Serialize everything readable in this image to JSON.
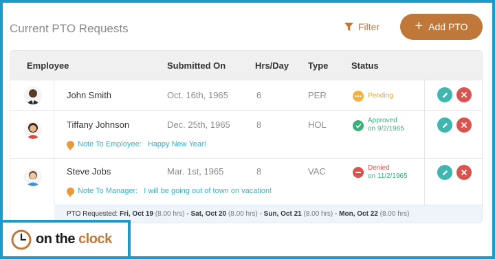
{
  "header": {
    "title": "Current PTO Requests",
    "filter_label": "Filter",
    "add_label": "Add PTO"
  },
  "table": {
    "columns": [
      "Employee",
      "Submitted On",
      "Hrs/Day",
      "Type",
      "Status"
    ],
    "rows": [
      {
        "name": "John Smith",
        "submitted": "Oct. 16th, 1965",
        "hrs": "6",
        "type": "PER",
        "status": "Pending",
        "status_date": ""
      },
      {
        "name": "Tiffany Johnson",
        "submitted": "Dec. 25th, 1965",
        "hrs": "8",
        "type": "HOL",
        "status": "Approved",
        "status_date": "on 9/2/1965",
        "note_label": "Note To Employee:",
        "note_text": "Happy New Year!"
      },
      {
        "name": "Steve Jobs",
        "submitted": "Mar. 1st, 1965",
        "hrs": "8",
        "type": "VAC",
        "status": "Denied",
        "status_date": "on 11/2/1965",
        "note_label": "Note To Manager:",
        "note_text": "I will be going out of town on vacation!"
      }
    ],
    "pto_summary": {
      "label": "PTO Requested:",
      "sep": "-",
      "days": [
        {
          "day": "Fri, Oct 19",
          "hrs": "(8.00 hrs)"
        },
        {
          "day": "Sat, Oct 20",
          "hrs": "(8.00 hrs)"
        },
        {
          "day": "Sun, Oct 21",
          "hrs": "(8.00 hrs)"
        },
        {
          "day": "Mon, Oct 22",
          "hrs": "(8.00 hrs)"
        }
      ]
    }
  },
  "logo": {
    "text_main": "on the",
    "text_accent": "clock"
  },
  "colors": {
    "accent": "#c0773a",
    "frame": "#1a9bc9",
    "pending": "#f5b041",
    "approved": "#3ab07a",
    "denied": "#d9534f",
    "edit": "#3fb6b0"
  }
}
